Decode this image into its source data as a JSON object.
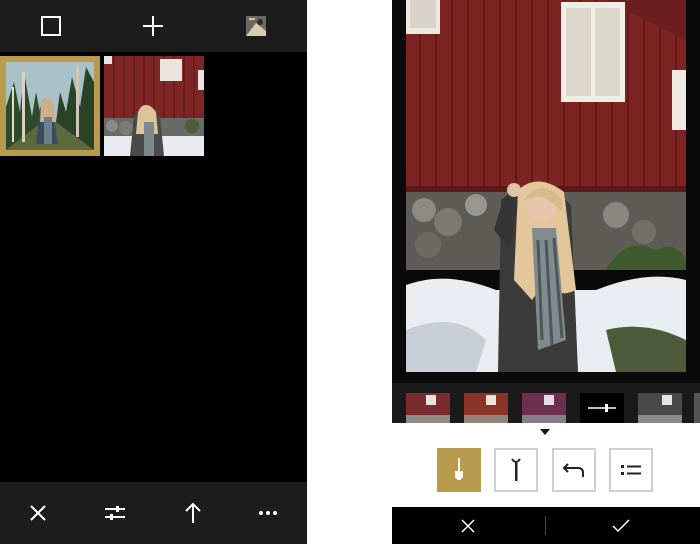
{
  "colors": {
    "accent": "#b89b4d",
    "toolbar_bg": "#1c1c1c",
    "canvas_bg": "#000000",
    "icon_light": "#ffffff",
    "tool_border": "#cfcfcf"
  },
  "library": {
    "top_bar": {
      "icons": [
        "select-square-icon",
        "add-plus-icon",
        "preview-thumbnail-icon"
      ]
    },
    "thumbnails": [
      {
        "name": "forest-photo-thumbnail",
        "selected": true
      },
      {
        "name": "barn-photo-thumbnail",
        "selected": false
      }
    ],
    "bottom_bar": {
      "icons": [
        "close-x-icon",
        "adjust-sliders-icon",
        "share-arrow-up-icon",
        "more-dots-icon"
      ]
    }
  },
  "editor": {
    "filter_strip": {
      "icons": [
        "filter-thumb-1",
        "filter-thumb-2",
        "filter-thumb-3",
        "filter-strength-slider-icon",
        "filter-thumb-bw"
      ],
      "active_index": 3
    },
    "tools": {
      "icons": [
        "brush-tool-icon",
        "selective-tool-icon",
        "undo-history-icon",
        "list-tool-icon"
      ],
      "active_index": 0
    },
    "bottom_bar": {
      "icons": [
        "cancel-x-icon",
        "confirm-check-icon"
      ]
    }
  }
}
